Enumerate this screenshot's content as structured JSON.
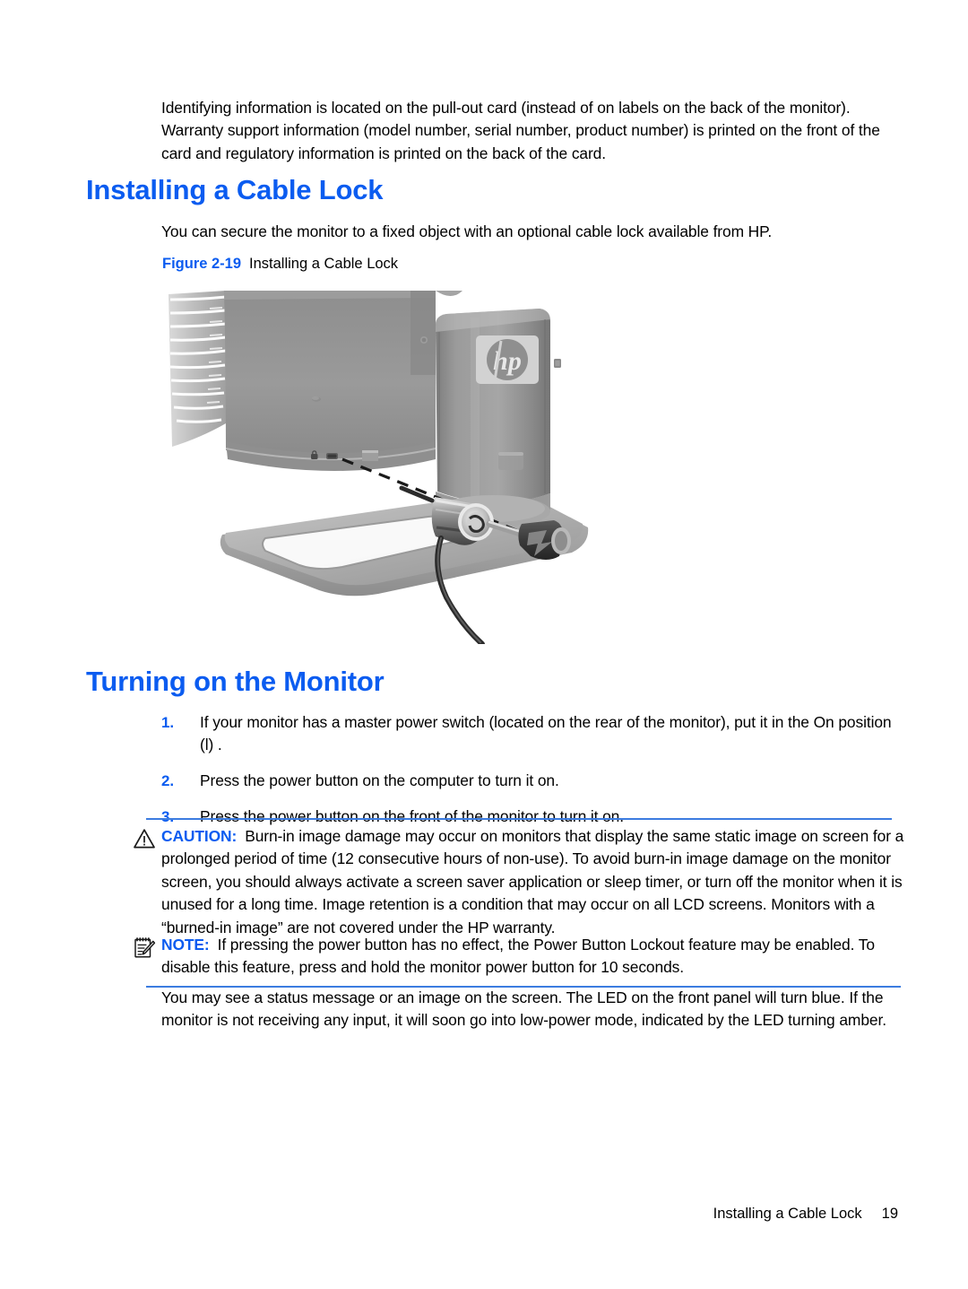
{
  "document": {
    "intro_paragraph": "Identifying information is located on the pull-out card (instead of on labels on the back of the monitor). Warranty support information (model number, serial number, product number) is printed on the front of the card and regulatory information is printed on the back of the card.",
    "sections": [
      {
        "heading": "Installing a Cable Lock",
        "paragraph": "You can secure the monitor to a fixed object with an optional cable lock available from HP.",
        "figure": {
          "label": "Figure 2-19",
          "title": "Installing a Cable Lock",
          "alt": "Rear view of an HP monitor on its stand with a cable lock being inserted into the security lock slot",
          "logo_text": "hp"
        }
      },
      {
        "heading": "Turning on the Monitor",
        "steps": [
          {
            "number": "1.",
            "text": "If your monitor has a master power switch (located on the rear of the monitor), put it in the On position (l) ."
          },
          {
            "number": "2.",
            "text": "Press the power button on the computer to turn it on."
          },
          {
            "number": "3.",
            "text": "Press the power button on the front of the monitor to turn it on."
          }
        ],
        "caution": {
          "keyword": "CAUTION:",
          "icon": "warning-triangle-icon",
          "text": "Burn-in image damage may occur on monitors that display the same static image on screen for a prolonged period of time (12 consecutive hours of non-use). To avoid burn-in image damage on the monitor screen, you should always activate a screen saver application or sleep timer, or turn off the monitor when it is unused for a long time. Image retention is a condition that may occur on all LCD screens. Monitors with a “burned-in image” are not covered under the HP warranty."
        },
        "note": {
          "keyword": "NOTE:",
          "icon": "notepad-pencil-icon",
          "text": "If pressing the power button has no effect, the Power Button Lockout feature may be enabled. To disable this feature, press and hold the monitor power button for 10 seconds."
        },
        "closing_paragraph": "You may see a status message or an image on the screen. The LED on the front panel will turn blue. If the monitor is not receiving any input, it will soon go into low-power mode, indicated by the LED turning amber."
      }
    ]
  },
  "footer": {
    "section_title": "Installing a Cable Lock",
    "page_number": "19"
  },
  "colors": {
    "heading_blue": "#0b5cf0",
    "rule_blue": "#3c7ce0",
    "body_black": "#000000",
    "page_background": "#ffffff"
  }
}
